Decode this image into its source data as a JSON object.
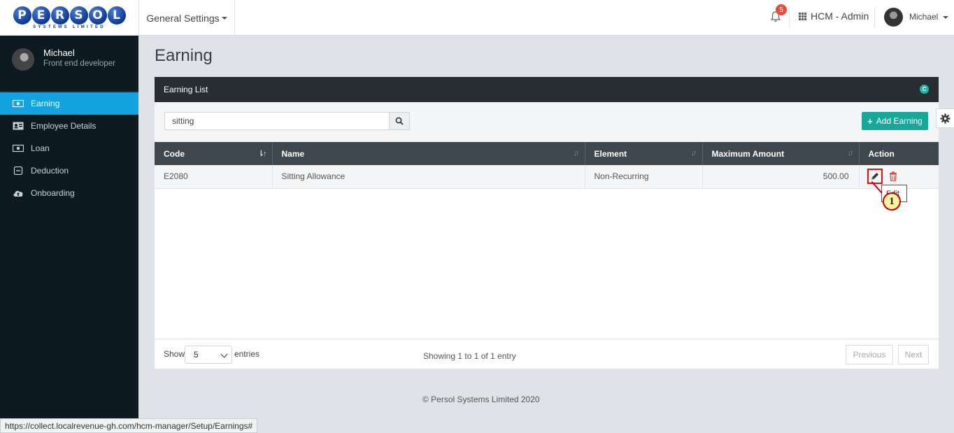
{
  "header": {
    "logo_letters": [
      "P",
      "E",
      "R",
      "S",
      "O",
      "L"
    ],
    "logo_sub": "SYSTEMS LIMITED",
    "menu_label": "General Settings",
    "notification_count": "5",
    "app_label": "HCM - Admin",
    "user_name": "Michael"
  },
  "sidebar": {
    "name": "Michael",
    "role": "Front end developer",
    "items": [
      {
        "label": "Earning",
        "icon": "money-icon",
        "active": true
      },
      {
        "label": "Employee Details",
        "icon": "id-card-icon"
      },
      {
        "label": "Loan",
        "icon": "money-icon"
      },
      {
        "label": "Deduction",
        "icon": "minus-square-icon"
      },
      {
        "label": "Onboarding",
        "icon": "cloud-upload-icon"
      }
    ]
  },
  "page": {
    "title": "Earning",
    "panel_title": "Earning List",
    "search_value": "sitting",
    "add_button": "Add Earning"
  },
  "table": {
    "columns": [
      "Code",
      "Name",
      "Element",
      "Maximum Amount",
      "Action"
    ],
    "rows": [
      {
        "code": "E2080",
        "name": "Sitting Allowance",
        "element": "Non-Recurring",
        "max_amount": "500.00"
      }
    ]
  },
  "table_footer": {
    "show_label": "Show",
    "entries_value": "5",
    "entries_label": "entries",
    "info": "Showing 1 to 1 of 1 entry",
    "prev": "Previous",
    "next": "Next"
  },
  "footer": "© Persol Systems Limited 2020",
  "status_url": "https://collect.localrevenue-gh.com/hcm-manager/Setup/Earnings#",
  "annotation": {
    "tooltip": "Edit",
    "step": "1"
  },
  "colors": {
    "accent": "#12a3e0",
    "add_button": "#17a89a",
    "delete": "#e74c3c",
    "sidebar": "#0e1a21"
  }
}
